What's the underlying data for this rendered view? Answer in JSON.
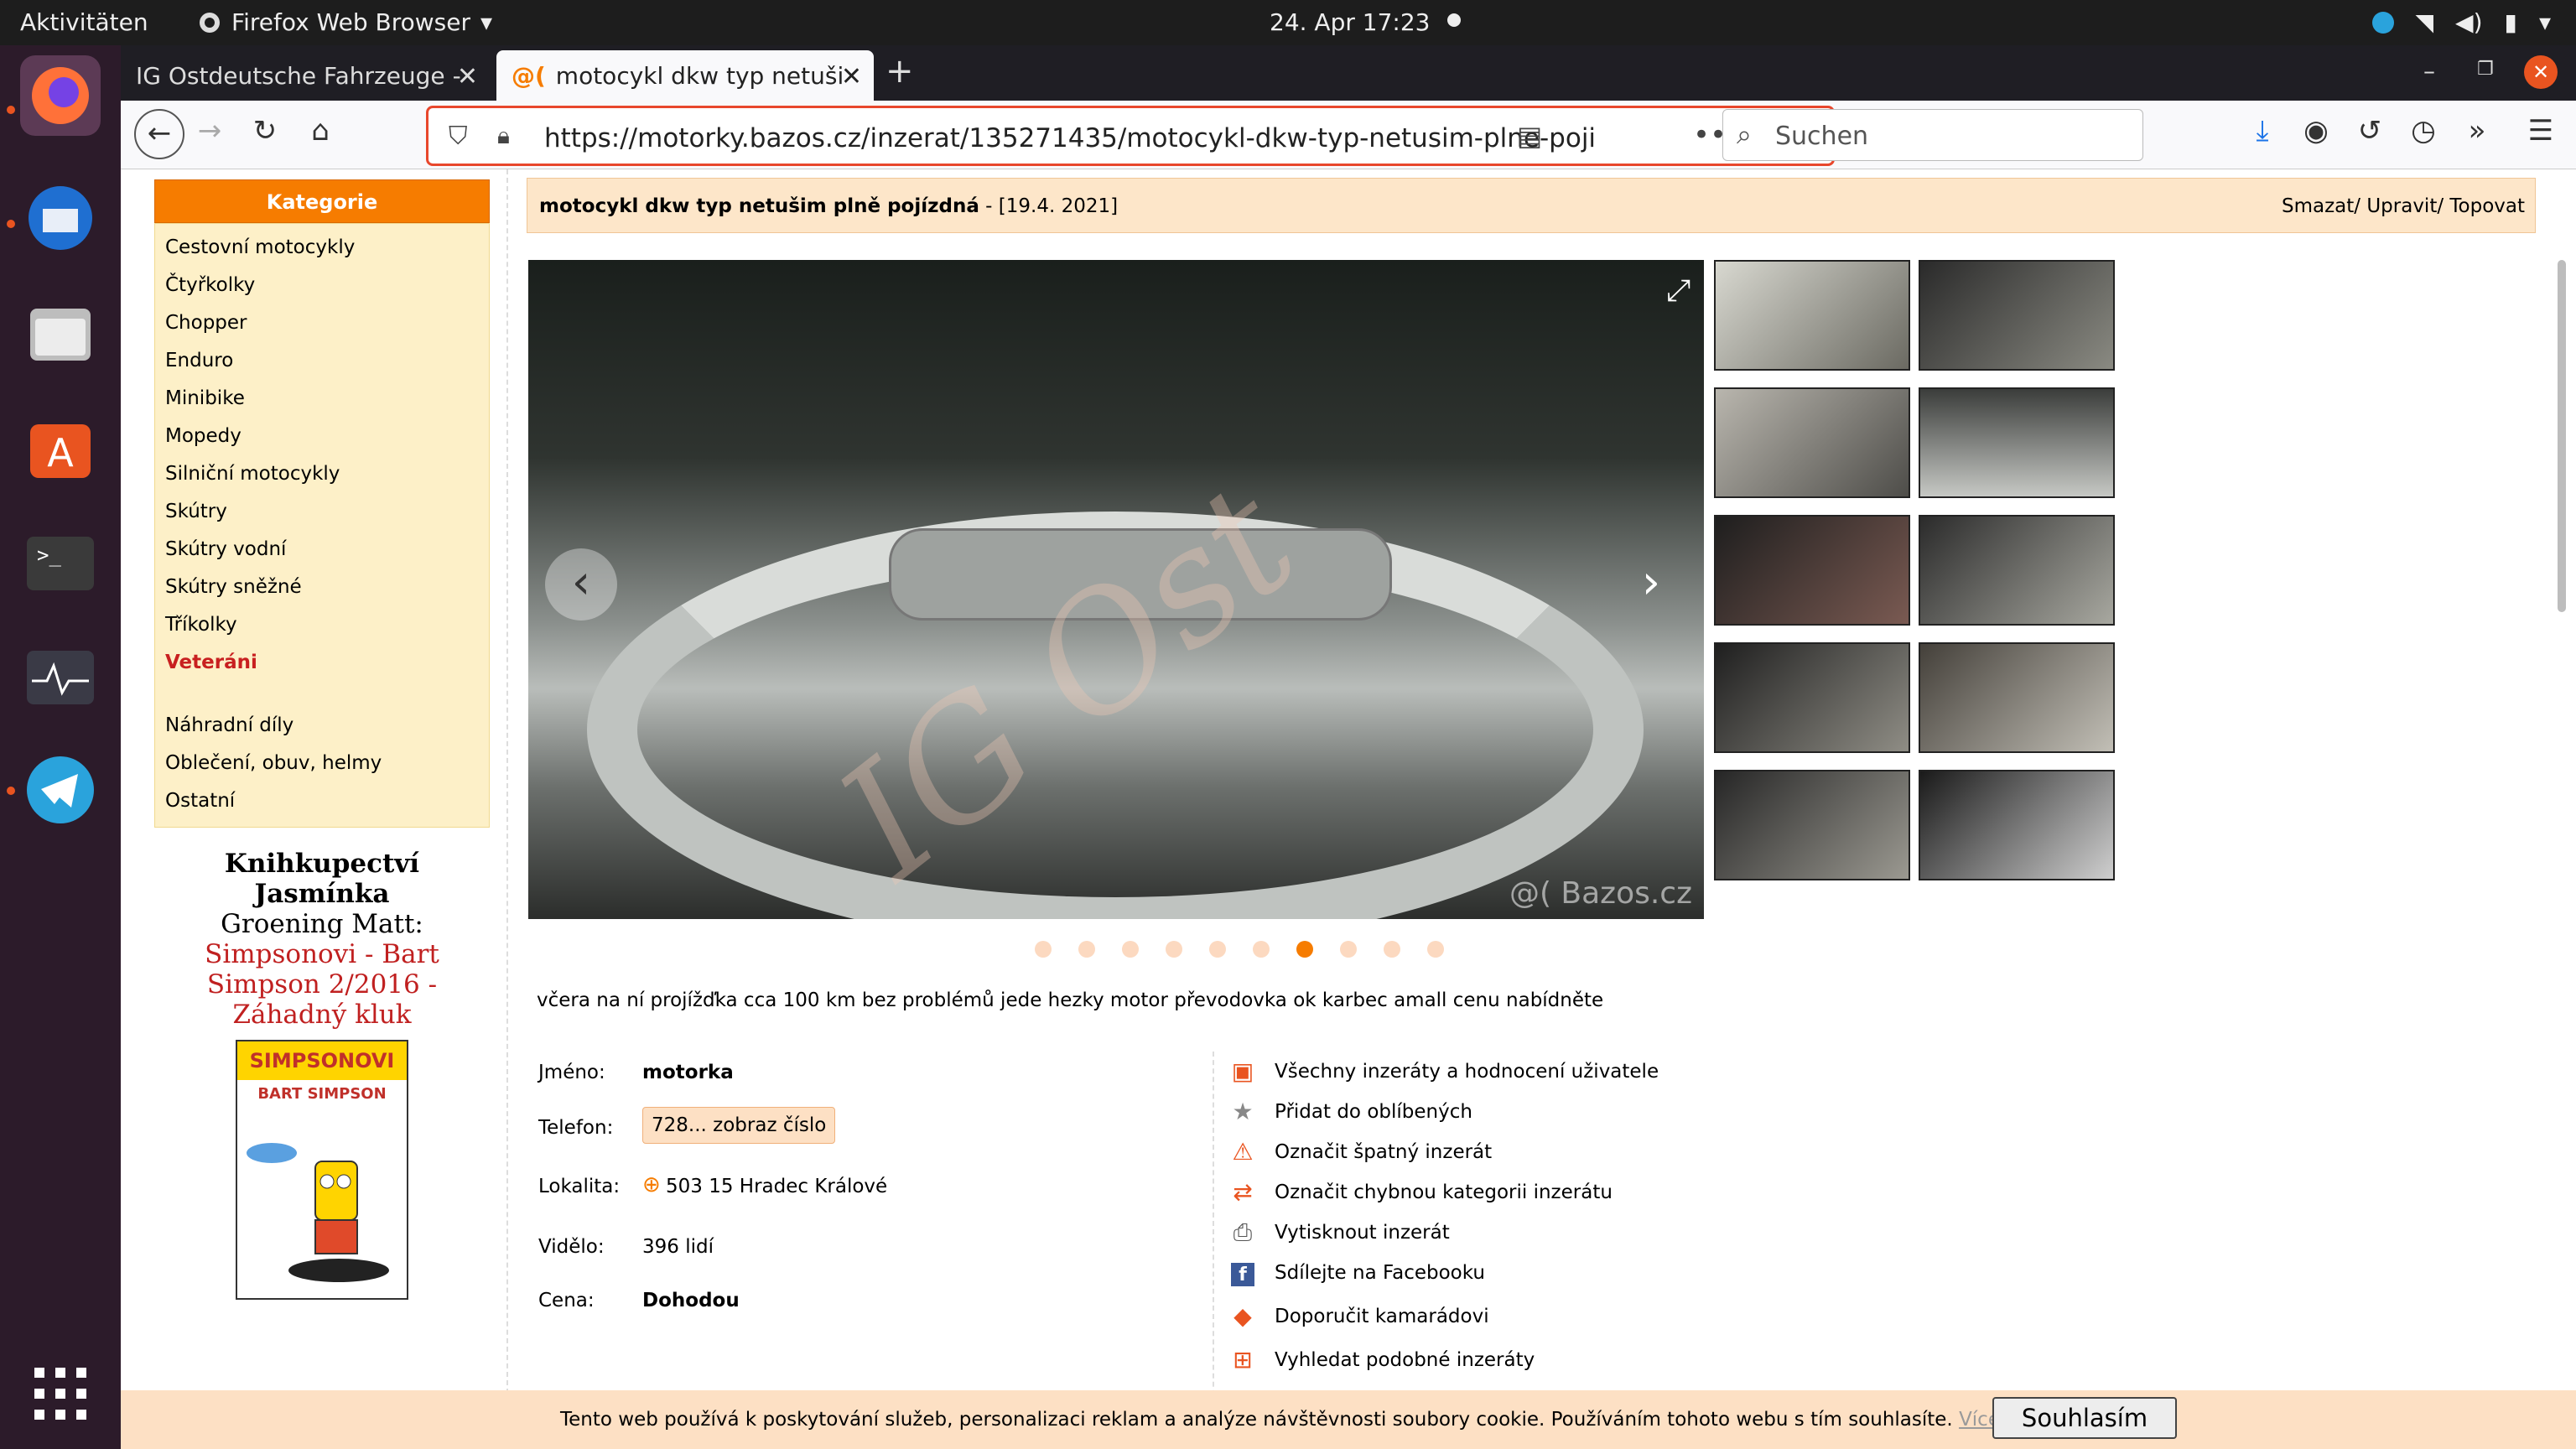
{
  "topbar": {
    "activities": "Aktivitäten",
    "app_name": "Firefox Web Browser",
    "clock": "24. Apr  17:23"
  },
  "tabs": [
    {
      "label": "IG Ostdeutsche Fahrzeuge -"
    },
    {
      "label": "motocykl dkw typ netuši"
    }
  ],
  "nav": {
    "url": "https://motorky.bazos.cz/inzerat/135271435/motocykl-dkw-typ-netusim-plne-poji",
    "search_placeholder": "Suchen"
  },
  "sidebar": {
    "header": "Kategorie",
    "items": [
      "Cestovní motocykly",
      "Čtyřkolky",
      "Chopper",
      "Enduro",
      "Minibike",
      "Mopedy",
      "Silniční motocykly",
      "Skútry",
      "Skútry vodní",
      "Skútry sněžné",
      "Tříkolky",
      "Veteráni"
    ],
    "items2": [
      "Náhradní díly",
      "Oblečení, obuv, helmy",
      "Ostatní"
    ]
  },
  "promo": {
    "line1": "Knihkupectví",
    "line2": "Jasmínka",
    "line3": "Groening Matt:",
    "line4": "Simpsonovi - Bart",
    "line5": "Simpson 2/2016 -",
    "line6": "Záhadný kluk",
    "book_title": "SIMPSONOVI",
    "book_sub": "BART SIMPSON"
  },
  "listing": {
    "title": "motocykl dkw typ netušim plně pojízdná",
    "date": " - [19.4. 2021]",
    "admin": "Smazat/ Upravit/ Topovat",
    "watermark": "@( Bazos.cz",
    "description": "včera na ní projížďka cca 100 km bez problémů jede hezky motor převodovka ok karbec amall cenu nabídněte",
    "name_label": "Jméno:",
    "name_value": "motorka",
    "phone_label": "Telefon:",
    "phone_value": "728... zobraz číslo",
    "loc_label": "Lokalita:",
    "loc_value": "503 15 Hradec Králové",
    "views_label": "Vidělo:",
    "views_value": "396 lidí",
    "price_label": "Cena:",
    "price_value": "Dohodou"
  },
  "actions": [
    "Všechny inzeráty a hodnocení uživatele",
    "Přidat do oblíbených",
    "Označit špatný inzerát",
    "Označit chybnou kategorii inzerátu",
    "Vytisknout inzerát",
    "Sdílejte na Facebooku",
    "Doporučit kamarádovi",
    "Vyhledat podobné inzeráty"
  ],
  "cookie": {
    "text": "Tento web používá k poskytování služeb, personalizaci reklam a analýze návštěvnosti soubory cookie. Používáním tohoto webu s tím souhlasíte. ",
    "link": "Více informací",
    "button": "Souhlasím"
  },
  "colors": {
    "accent": "#f67c00",
    "url_focus": "#e8472c",
    "category_bg": "#fdf0c8",
    "selected": "#c82020"
  }
}
